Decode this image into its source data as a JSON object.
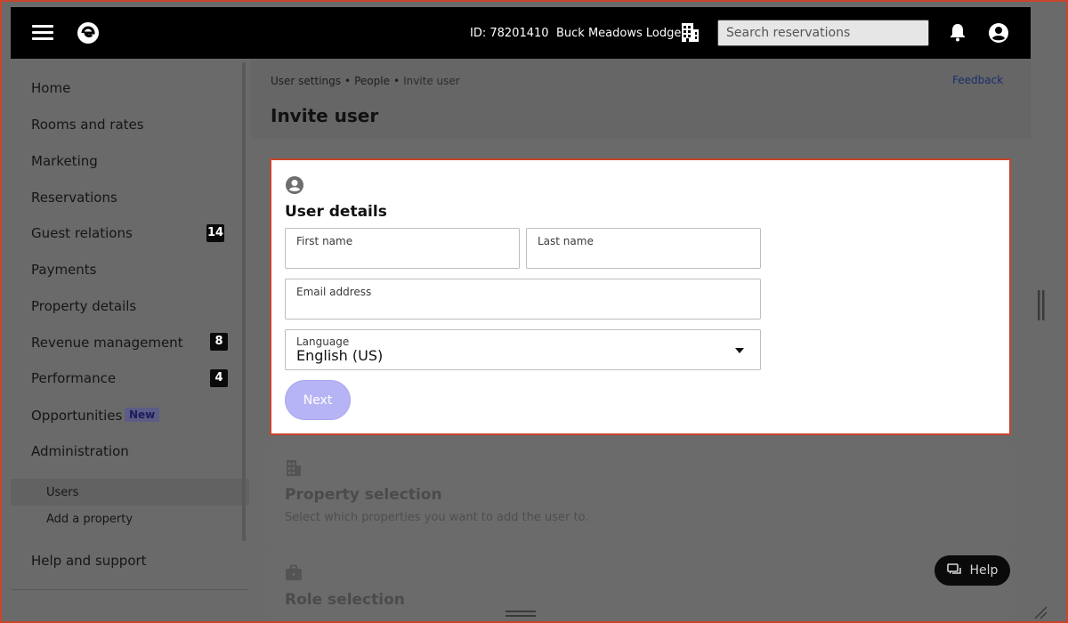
{
  "topbar": {
    "property_id": "ID: 78201410",
    "property_name": "Buck Meadows Lodge",
    "search_placeholder": "Search reservations"
  },
  "sidebar": {
    "items": [
      {
        "label": "Home"
      },
      {
        "label": "Rooms and rates"
      },
      {
        "label": "Marketing"
      },
      {
        "label": "Reservations"
      },
      {
        "label": "Guest relations",
        "badge": "14"
      },
      {
        "label": "Payments"
      },
      {
        "label": "Property details"
      },
      {
        "label": "Revenue management",
        "badge": "8"
      },
      {
        "label": "Performance",
        "badge": "4"
      },
      {
        "label": "Opportunities",
        "tag": "New"
      },
      {
        "label": "Administration"
      }
    ],
    "sub_items": [
      {
        "label": "Users",
        "active": true
      },
      {
        "label": "Add a property"
      }
    ],
    "help_support": "Help and support"
  },
  "header": {
    "breadcrumb": [
      "User settings",
      "People",
      "Invite user"
    ],
    "feedback": "Feedback",
    "title": "Invite user"
  },
  "user_details": {
    "title": "User details",
    "first_name_label": "First name",
    "first_name_value": "",
    "last_name_label": "Last name",
    "last_name_value": "",
    "email_label": "Email address",
    "email_value": "",
    "language_label": "Language",
    "language_value": "English (US)",
    "next_label": "Next"
  },
  "property_selection": {
    "title": "Property selection",
    "description": "Select which properties you want to add the user to."
  },
  "role_selection": {
    "title": "Role selection"
  },
  "help": {
    "label": "Help"
  },
  "colors": {
    "accent": "#b7b4f5",
    "highlight_border": "#c9452a",
    "topbar": "#000000"
  }
}
